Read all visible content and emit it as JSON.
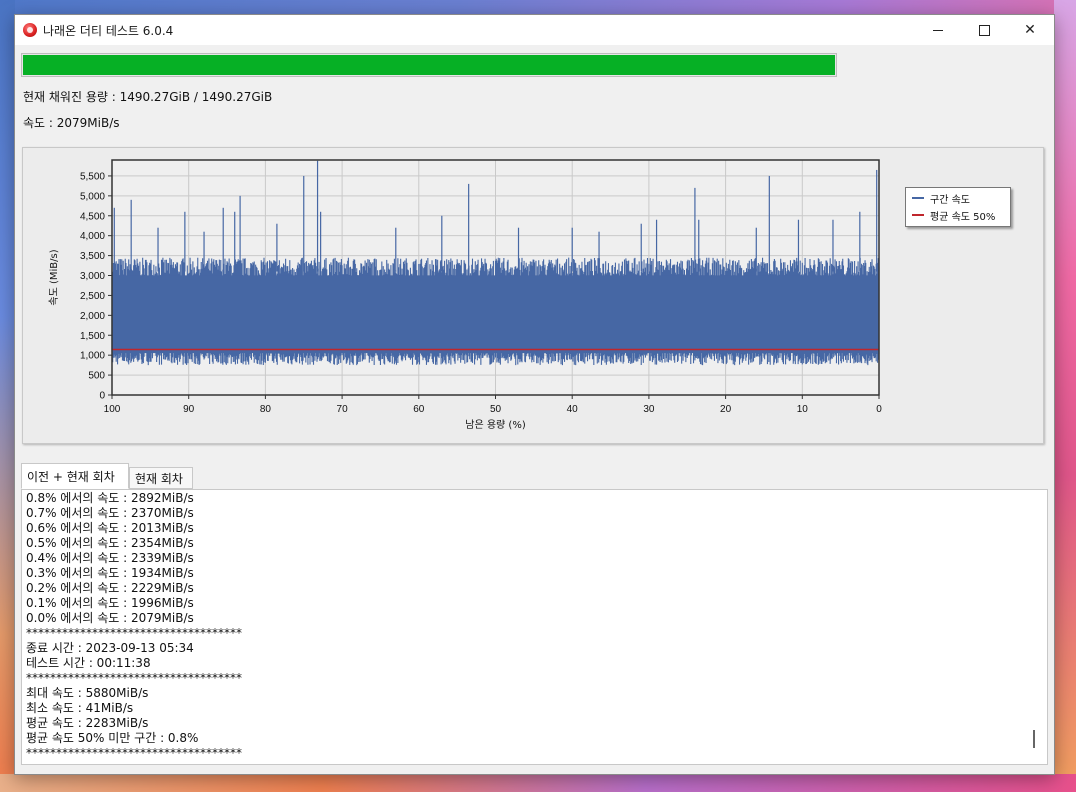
{
  "window": {
    "title": "나래온 더티 테스트 6.0.4"
  },
  "progress": {
    "fraction": 1.0
  },
  "status": {
    "capacity": "현재 채워진 용량 : 1490.27GiB / 1490.27GiB",
    "speed": "속도 : 2079MiB/s"
  },
  "chart_data": {
    "type": "area",
    "ylabel": "속도 (MiB/s)",
    "xlabel": "남은 용량 (%)",
    "xlim": [
      100,
      0
    ],
    "ylim": [
      0,
      5900
    ],
    "x_ticks": [
      "100",
      "90",
      "80",
      "70",
      "60",
      "50",
      "40",
      "30",
      "20",
      "10",
      "0"
    ],
    "y_ticks": [
      "0",
      "500",
      "1,000",
      "1,500",
      "2,000",
      "2,500",
      "3,000",
      "3,500",
      "4,000",
      "4,500",
      "5,000",
      "5,500"
    ],
    "y_tick_values": [
      0,
      500,
      1000,
      1500,
      2000,
      2500,
      3000,
      3500,
      4000,
      4500,
      5000,
      5500
    ],
    "grid": true,
    "legend_position": "right",
    "series": [
      {
        "name": "구간 속도",
        "color": "#4667a4",
        "band_low": 900,
        "band_high": 3100,
        "x": [
          100,
          0.8,
          0.7,
          0.6,
          0.5,
          0.4,
          0.3,
          0.2,
          0.1,
          0.0
        ],
        "y": [
          null,
          2892,
          2370,
          2013,
          2354,
          2339,
          1934,
          2229,
          1996,
          2079
        ],
        "peaks_x": [
          99.7,
          97.5,
          94,
          90.5,
          88,
          85.5,
          84,
          83.3,
          78.5,
          75,
          73.2,
          72.8,
          63,
          57,
          53.5,
          47,
          40,
          36.5,
          31,
          29,
          24,
          23.5,
          16,
          14.3,
          10.5,
          6,
          2.5,
          0.3
        ],
        "peaks_y": [
          4700,
          4900,
          4200,
          4600,
          4100,
          4700,
          4600,
          5000,
          4300,
          5500,
          5880,
          4600,
          4200,
          4500,
          5300,
          4200,
          4200,
          4100,
          4300,
          4400,
          5200,
          4400,
          4200,
          5500,
          4400,
          4400,
          4600,
          5650
        ]
      },
      {
        "name": "평균 속도 50%",
        "color": "#c0262c",
        "values": [
          1141
        ]
      }
    ]
  },
  "tabs": [
    {
      "label": "이전 + 현재 회차"
    },
    {
      "label": "현재 회차"
    }
  ],
  "log": [
    "0.8% 에서의 속도 : 2892MiB/s",
    "0.7% 에서의 속도 : 2370MiB/s",
    "0.6% 에서의 속도 : 2013MiB/s",
    "0.5% 에서의 속도 : 2354MiB/s",
    "0.4% 에서의 속도 : 2339MiB/s",
    "0.3% 에서의 속도 : 1934MiB/s",
    "0.2% 에서의 속도 : 2229MiB/s",
    "0.1% 에서의 속도 : 1996MiB/s",
    "0.0% 에서의 속도 : 2079MiB/s",
    "************************************",
    "종료 시간 : 2023-09-13 05:34",
    "테스트 시간 : 00:11:38",
    "************************************",
    "최대 속도 : 5880MiB/s",
    "최소 속도 : 41MiB/s",
    "평균 속도 : 2283MiB/s",
    "평균 속도 50% 미만 구간 : 0.8%",
    "************************************"
  ]
}
